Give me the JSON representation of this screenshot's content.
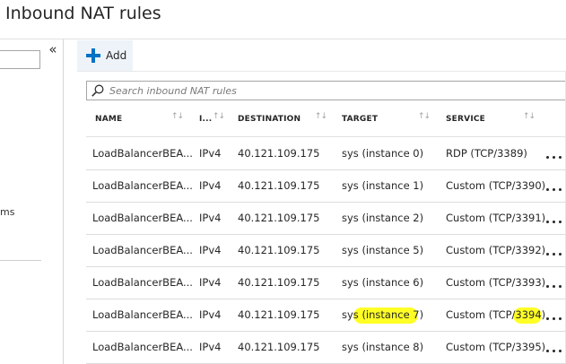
{
  "page": {
    "title": "Inbound NAT rules"
  },
  "left_panel": {
    "collapse_glyph": "«",
    "item_fragment": "ms"
  },
  "toolbar": {
    "add_label": "Add",
    "add_icon": "plus-icon",
    "accent": "#0072c6"
  },
  "search": {
    "placeholder": "Search inbound NAT rules",
    "value": ""
  },
  "table": {
    "columns": [
      {
        "label": "NAME"
      },
      {
        "label": "I..."
      },
      {
        "label": "DESTINATION"
      },
      {
        "label": "TARGET"
      },
      {
        "label": "SERVICE"
      }
    ],
    "rows": [
      {
        "name": "LoadBalancerBEA...",
        "ip": "IPv4",
        "destination": "40.121.109.175",
        "target": "sys (instance 0)",
        "service": "RDP (TCP/3389)"
      },
      {
        "name": "LoadBalancerBEA...",
        "ip": "IPv4",
        "destination": "40.121.109.175",
        "target": "sys (instance 1)",
        "service": "Custom (TCP/3390)"
      },
      {
        "name": "LoadBalancerBEA...",
        "ip": "IPv4",
        "destination": "40.121.109.175",
        "target": "sys (instance 2)",
        "service": "Custom (TCP/3391)"
      },
      {
        "name": "LoadBalancerBEA...",
        "ip": "IPv4",
        "destination": "40.121.109.175",
        "target": "sys (instance 5)",
        "service": "Custom (TCP/3392)"
      },
      {
        "name": "LoadBalancerBEA...",
        "ip": "IPv4",
        "destination": "40.121.109.175",
        "target": "sys (instance 6)",
        "service": "Custom (TCP/3393)"
      },
      {
        "name": "LoadBalancerBEA...",
        "ip": "IPv4",
        "destination": "40.121.109.175",
        "target": "sys (instance 7)",
        "service": "Custom (TCP/3394)"
      },
      {
        "name": "LoadBalancerBEA...",
        "ip": "IPv4",
        "destination": "40.121.109.175",
        "target": "sys (instance 8)",
        "service": "Custom (TCP/3395)"
      }
    ],
    "highlight_color": "#ffff00"
  }
}
